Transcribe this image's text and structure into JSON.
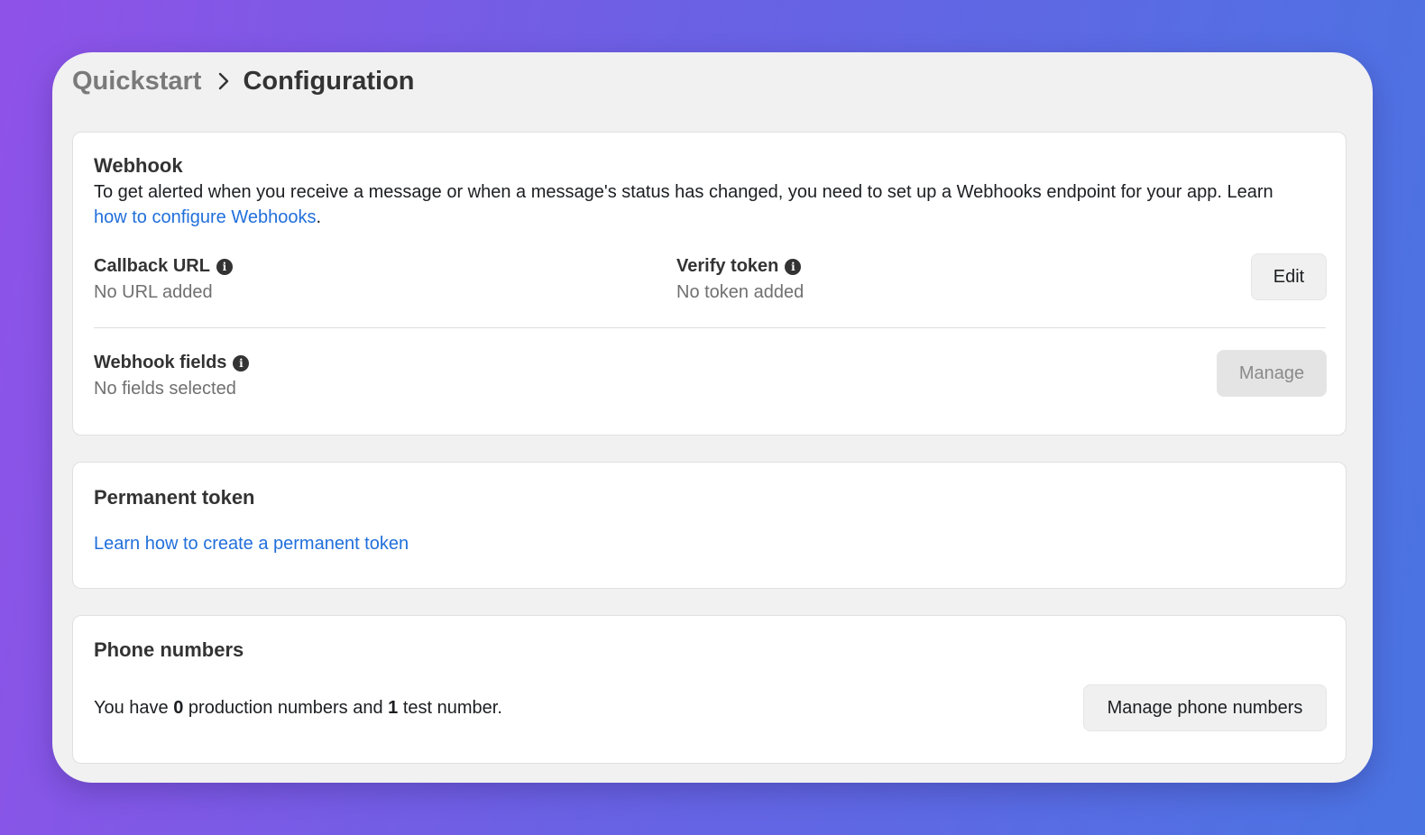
{
  "breadcrumb": {
    "parent": "Quickstart",
    "current": "Configuration"
  },
  "webhook": {
    "title": "Webhook",
    "description": "To get alerted when you receive a message or when a message's status has changed, you need to set up a Webhooks endpoint for your app. Learn",
    "link_text": "how to configure Webhooks",
    "link_suffix": ".",
    "callback_label": "Callback URL",
    "callback_value": "No URL added",
    "verify_label": "Verify token",
    "verify_value": "No token added",
    "edit_label": "Edit",
    "fields_label": "Webhook fields",
    "fields_value": "No fields selected",
    "manage_label": "Manage"
  },
  "permanent_token": {
    "title": "Permanent token",
    "link_text": "Learn how to create a permanent token"
  },
  "phone_numbers": {
    "title": "Phone numbers",
    "text_prefix": "You have ",
    "production_count": "0",
    "text_middle": " production numbers and ",
    "test_count": "1",
    "text_suffix": " test number.",
    "manage_label": "Manage phone numbers"
  },
  "colors": {
    "link": "#216fdb",
    "background_gradient_start": "#8f52e8",
    "background_gradient_end": "#4a74e2"
  }
}
